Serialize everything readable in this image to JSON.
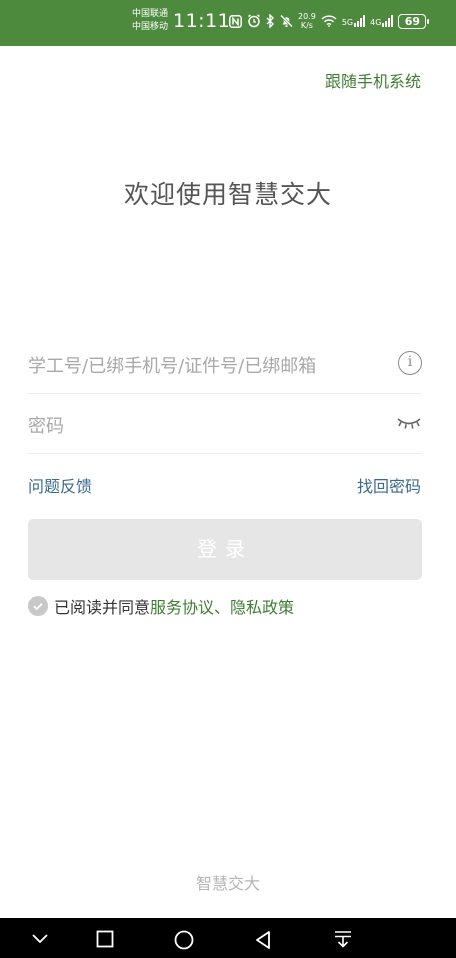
{
  "status_bar": {
    "carrier1": "中国联通",
    "carrier2": "中国移动",
    "time": "11:11",
    "net_speed_value": "20.9",
    "net_speed_unit": "K/s",
    "signal1_label": "5G",
    "signal2_label": "4G",
    "battery": "69",
    "icons": [
      "nfc-icon",
      "alarm-icon",
      "bluetooth-icon",
      "mute-icon",
      "wifi-icon"
    ]
  },
  "header": {
    "follow_system": "跟随手机系统"
  },
  "welcome": "欢迎使用智慧交大",
  "form": {
    "account_placeholder": "学工号/已绑手机号/证件号/已绑邮箱",
    "password_placeholder": "密码"
  },
  "links": {
    "feedback": "问题反馈",
    "forgot_password": "找回密码"
  },
  "login_button": "登录",
  "agreement": {
    "prefix": "已阅读并同意",
    "terms": "服务协议、隐私政策"
  },
  "footer": "智慧交大",
  "colors": {
    "status_bar": "#4e8a3e",
    "accent_green": "#3f7d33",
    "link_blue": "#3a6a8f",
    "button_disabled": "#e6e6e6"
  }
}
